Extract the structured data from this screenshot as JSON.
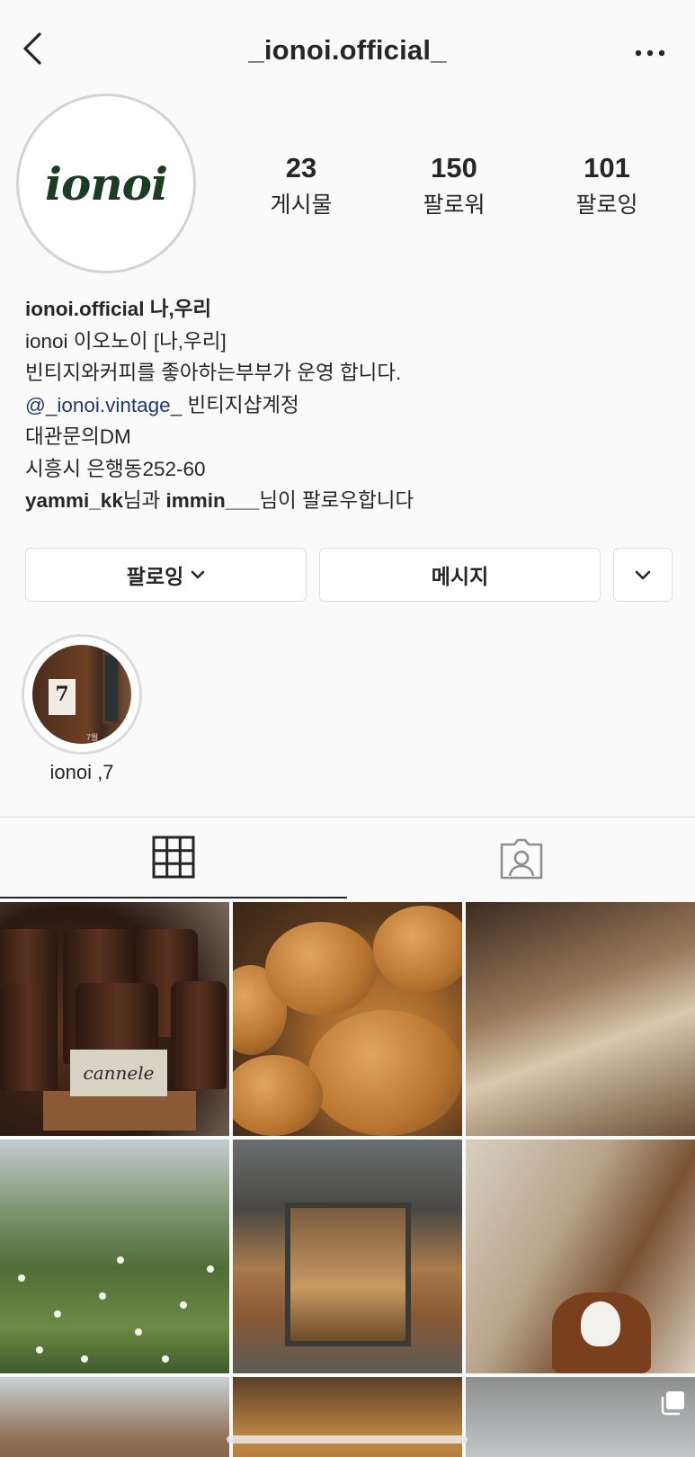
{
  "header": {
    "username": "_ionoi.official_",
    "back_icon": "chevron-left-icon",
    "more_icon": "more-horizontal-icon"
  },
  "profile": {
    "avatar_logo_text": "ionoi",
    "stats": [
      {
        "value": "23",
        "label": "게시물"
      },
      {
        "value": "150",
        "label": "팔로워"
      },
      {
        "value": "101",
        "label": "팔로잉"
      }
    ]
  },
  "bio": {
    "name": "ionoi.official 나,우리",
    "line1": "ionoi 이오노이 [나,우리]",
    "line2": "빈티지와커피를 좋아하는부부가 운영 합니다.",
    "link": "@_ionoi.vintage_",
    "link_suffix": " 빈티지샵계정",
    "line4": "대관문의DM",
    "line5": "시흥시 은행동252-60",
    "followed_by_user1": "yammi_kk",
    "followed_by_mid": "님과 ",
    "followed_by_user2": "immin___",
    "followed_by_suffix": "님이 팔로우합니다"
  },
  "actions": {
    "following_label": "팔로잉",
    "message_label": "메시지"
  },
  "highlight": {
    "label": "ionoi ,7",
    "calendar_number": "7",
    "calendar_month": "7월"
  },
  "tabs": {
    "grid_icon": "grid-icon",
    "tagged_icon": "tagged-person-icon"
  },
  "posts": {
    "first_post_card_text": "cannele"
  },
  "colors": {
    "background": "#fafafa",
    "text": "#262626",
    "border": "#dbdbdb",
    "link": "#1e3a6b",
    "logo_green": "#1d3d23"
  }
}
